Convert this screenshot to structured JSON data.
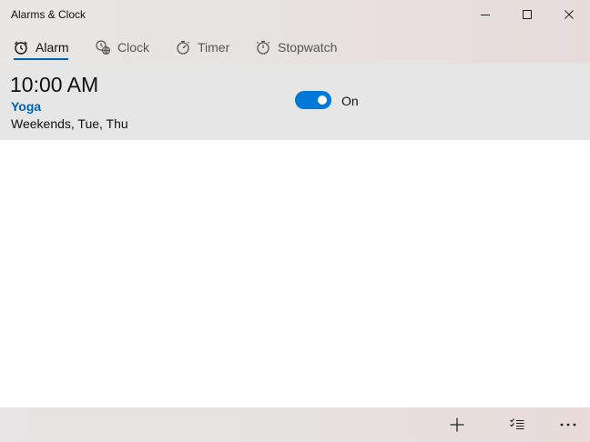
{
  "window": {
    "title": "Alarms & Clock"
  },
  "tabs": [
    {
      "label": "Alarm",
      "icon": "alarm-clock-icon",
      "active": true
    },
    {
      "label": "Clock",
      "icon": "world-clock-icon",
      "active": false
    },
    {
      "label": "Timer",
      "icon": "timer-icon",
      "active": false
    },
    {
      "label": "Stopwatch",
      "icon": "stopwatch-icon",
      "active": false
    }
  ],
  "alarms": [
    {
      "time": "10:00 AM",
      "name": "Yoga",
      "days": "Weekends, Tue, Thu",
      "toggle_label": "On",
      "enabled": true
    }
  ],
  "command_bar": {
    "add_icon": "plus-icon",
    "select_icon": "select-list-icon",
    "more_icon": "more-ellipsis-icon"
  },
  "colors": {
    "accent": "#0078d7",
    "accent_text": "#0063b1",
    "card_bg": "#e6e6e6"
  }
}
